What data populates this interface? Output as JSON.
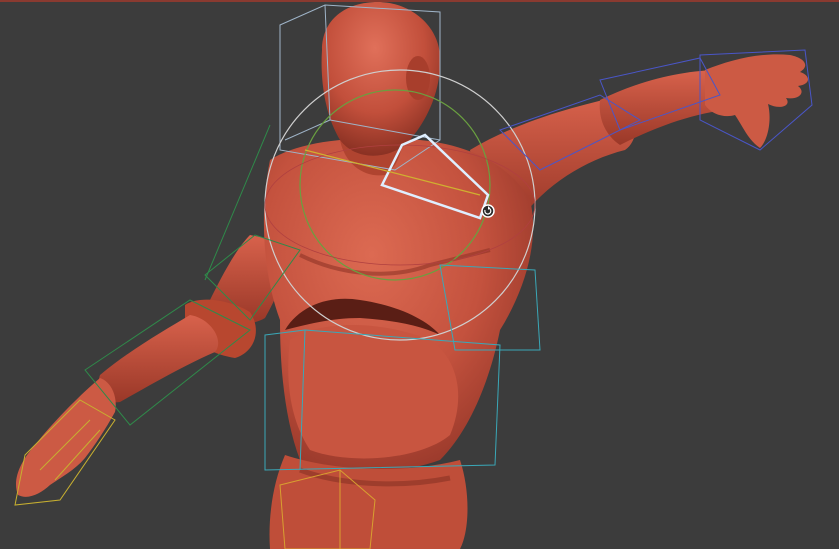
{
  "viewport": {
    "background": "#3c3c3c",
    "top_border_color": "#8a3a30"
  },
  "model": {
    "skin_color": "#c4523e",
    "skin_shadow": "#8f3326",
    "skin_highlight": "#dc6a52"
  },
  "rig": {
    "bone_box_color": "#9fb4c8",
    "selected_bone_color": "#dfefff",
    "left_arm_color": "#2f8a4a",
    "right_arm_color": "#4a56c8",
    "hand_color": "#c8b030",
    "hip_color": "#d8a030",
    "torso_color": "#3aa8b8",
    "gizmo_ring_color": "#cfcfcf",
    "gizmo_inner_color": "#6aa040"
  },
  "icons": {
    "rotate": "rotate-icon"
  }
}
